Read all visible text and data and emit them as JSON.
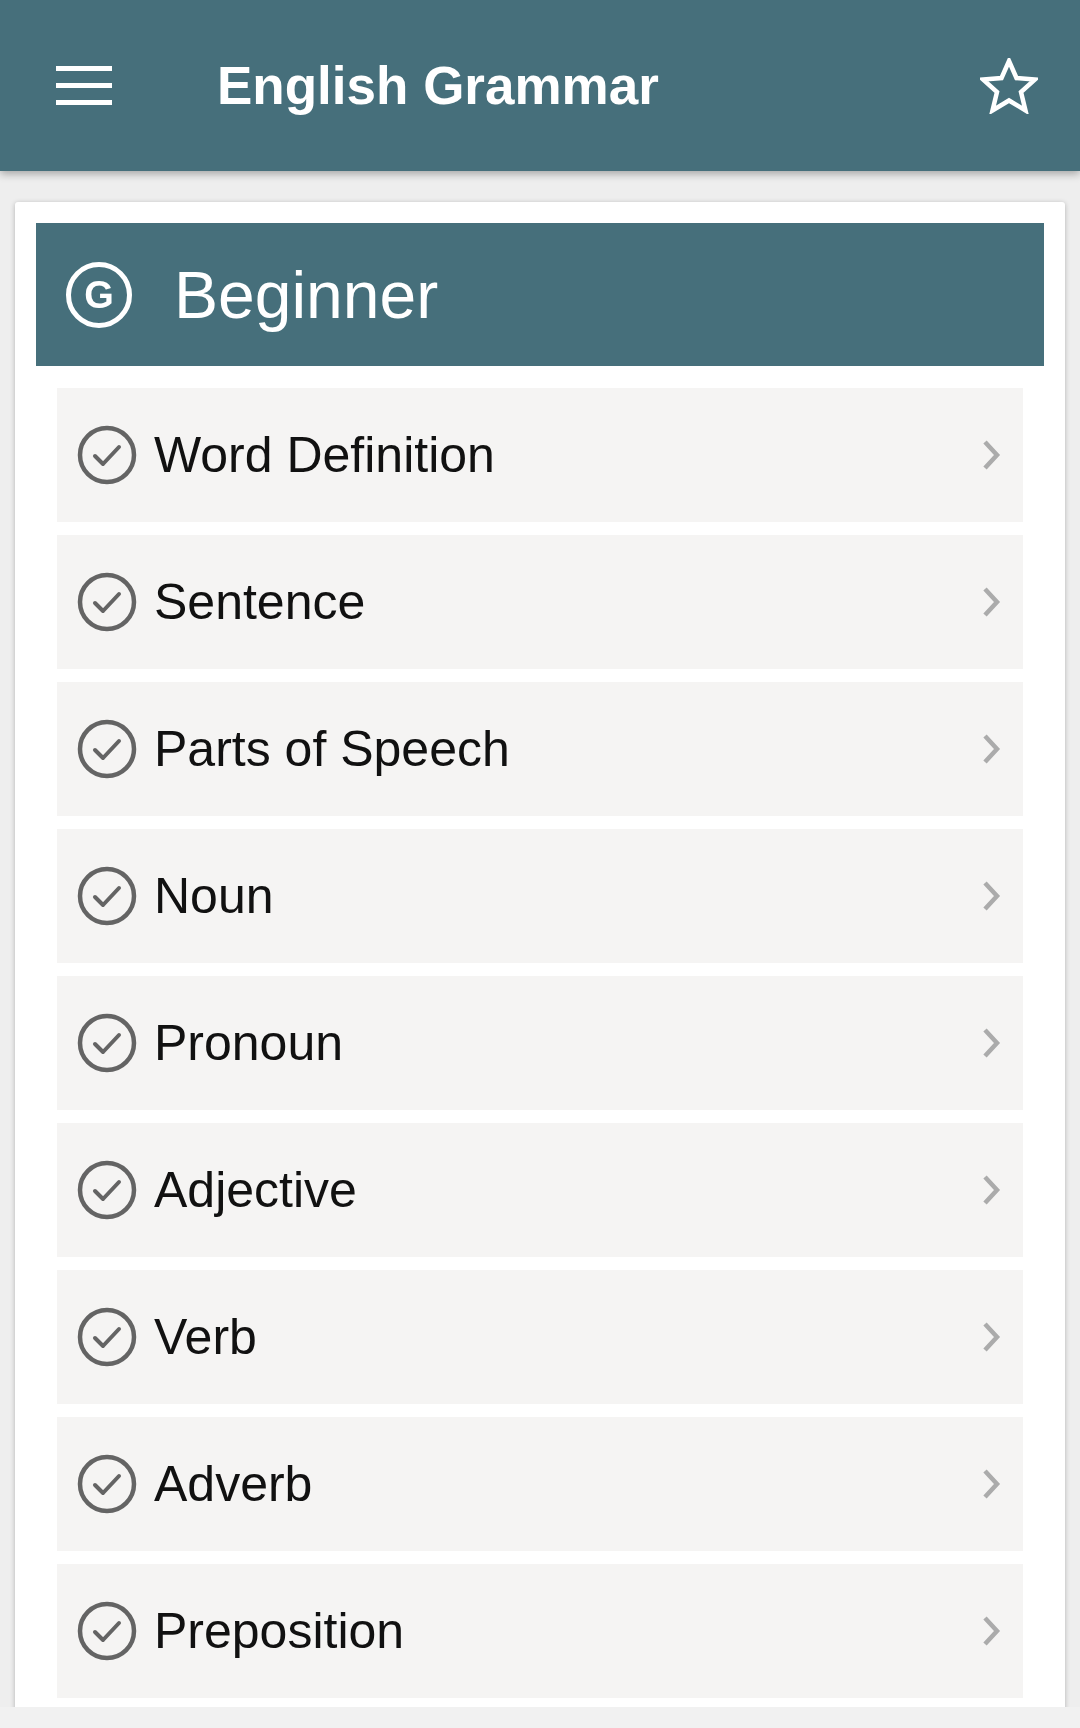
{
  "app_bar": {
    "title": "English Grammar"
  },
  "section": {
    "badge": "G",
    "title": "Beginner"
  },
  "lessons": [
    {
      "title": "Word Definition"
    },
    {
      "title": "Sentence"
    },
    {
      "title": "Parts of Speech"
    },
    {
      "title": "Noun"
    },
    {
      "title": "Pronoun"
    },
    {
      "title": "Adjective"
    },
    {
      "title": "Verb"
    },
    {
      "title": "Adverb"
    },
    {
      "title": "Preposition"
    }
  ]
}
